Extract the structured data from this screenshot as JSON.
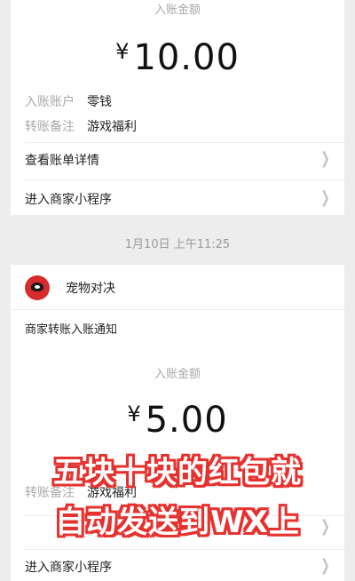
{
  "card1": {
    "amount_label": "入账金额",
    "amount": "10.00",
    "currency": "¥",
    "account_label": "入账账户",
    "account_value": "零钱",
    "note_label": "转账备注",
    "note_value": "游戏福利",
    "bill_details": "查看账单详情",
    "mini_program": "进入商家小程序"
  },
  "timestamp": "1月10日 上午11:25",
  "card2": {
    "merchant_name": "宠物对决",
    "notice_title": "商家转账入账通知",
    "amount_label": "入账金额",
    "amount": "5.00",
    "currency": "¥",
    "note_label": "转账备注",
    "note_value": "游戏福利",
    "mini_program": "进入商家小程序"
  },
  "overlay": {
    "line1": "五块十块的红包就",
    "line2": "自动发送到WX上"
  },
  "icons": {
    "chevron": "chevron-right-icon",
    "avatar": "merchant-avatar-icon"
  },
  "colors": {
    "overlay_outline": "#e6322f",
    "background": "#ededed"
  }
}
